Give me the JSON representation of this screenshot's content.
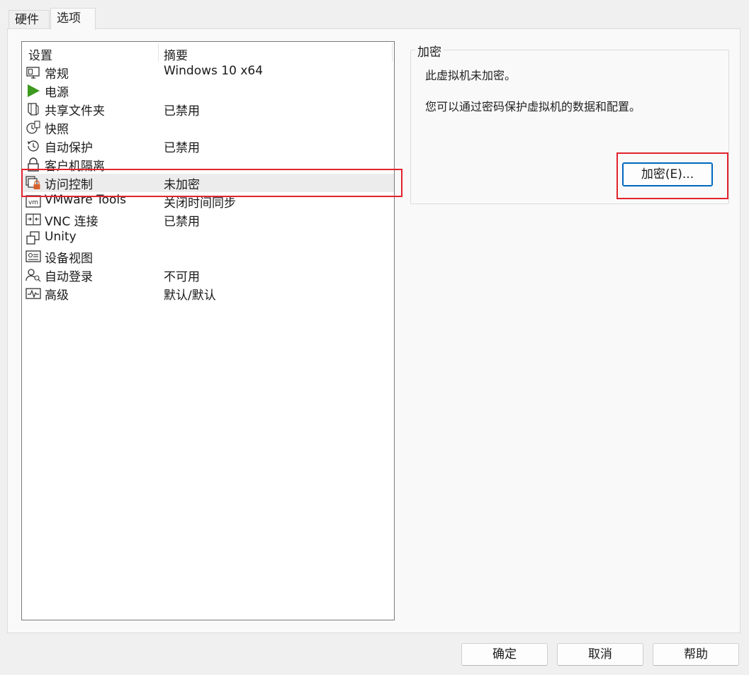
{
  "tabs": [
    {
      "label": "硬件"
    },
    {
      "label": "选项"
    }
  ],
  "list": {
    "headers": {
      "setting": "设置",
      "summary": "摘要"
    },
    "rows": [
      {
        "icon": "monitor-icon",
        "name": "常规",
        "summary": "Windows 10 x64"
      },
      {
        "icon": "power-play-icon",
        "name": "电源",
        "summary": ""
      },
      {
        "icon": "shared-folder-icon",
        "name": "共享文件夹",
        "summary": "已禁用"
      },
      {
        "icon": "snapshot-clock-icon",
        "name": "快照",
        "summary": ""
      },
      {
        "icon": "history-clock-icon",
        "name": "自动保护",
        "summary": "已禁用"
      },
      {
        "icon": "padlock-icon",
        "name": "客户机隔离",
        "summary": ""
      },
      {
        "icon": "access-lock-icon",
        "name": "访问控制",
        "summary": "未加密"
      },
      {
        "icon": "vm-icon",
        "name": "VMware Tools",
        "summary": "关闭时间同步"
      },
      {
        "icon": "vnc-icon",
        "name": "VNC 连接",
        "summary": "已禁用"
      },
      {
        "icon": "unity-windows-icon",
        "name": "Unity",
        "summary": ""
      },
      {
        "icon": "device-view-icon",
        "name": "设备视图",
        "summary": ""
      },
      {
        "icon": "user-login-icon",
        "name": "自动登录",
        "summary": "不可用"
      },
      {
        "icon": "pulse-icon",
        "name": "高级",
        "summary": "默认/默认"
      }
    ]
  },
  "encryption": {
    "group_title": "加密",
    "status_text": "此虚拟机未加密。",
    "info_text": "您可以通过密码保护虚拟机的数据和配置。",
    "encrypt_button": "加密(E)..."
  },
  "footer": {
    "ok": "确定",
    "cancel": "取消",
    "help": "帮助"
  },
  "colors": {
    "play_green": "#3c9a1e",
    "highlight_red": "#e2242e",
    "focus_blue": "#0067c0",
    "lock_orange": "#d9602b"
  }
}
